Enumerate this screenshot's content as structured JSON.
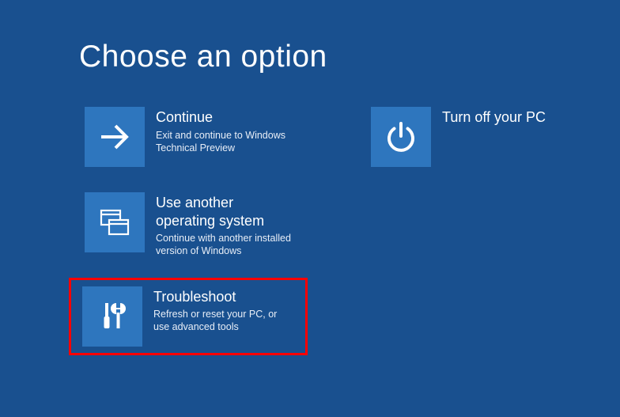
{
  "title": "Choose an option",
  "left": [
    {
      "title": "Continue",
      "desc": "Exit and continue to Windows Technical Preview"
    },
    {
      "title": "Use another operating system",
      "desc": "Continue with another installed version of Windows"
    },
    {
      "title": "Troubleshoot",
      "desc": "Refresh or reset your PC, or use advanced tools"
    }
  ],
  "right": [
    {
      "title": "Turn off your PC",
      "desc": ""
    }
  ]
}
